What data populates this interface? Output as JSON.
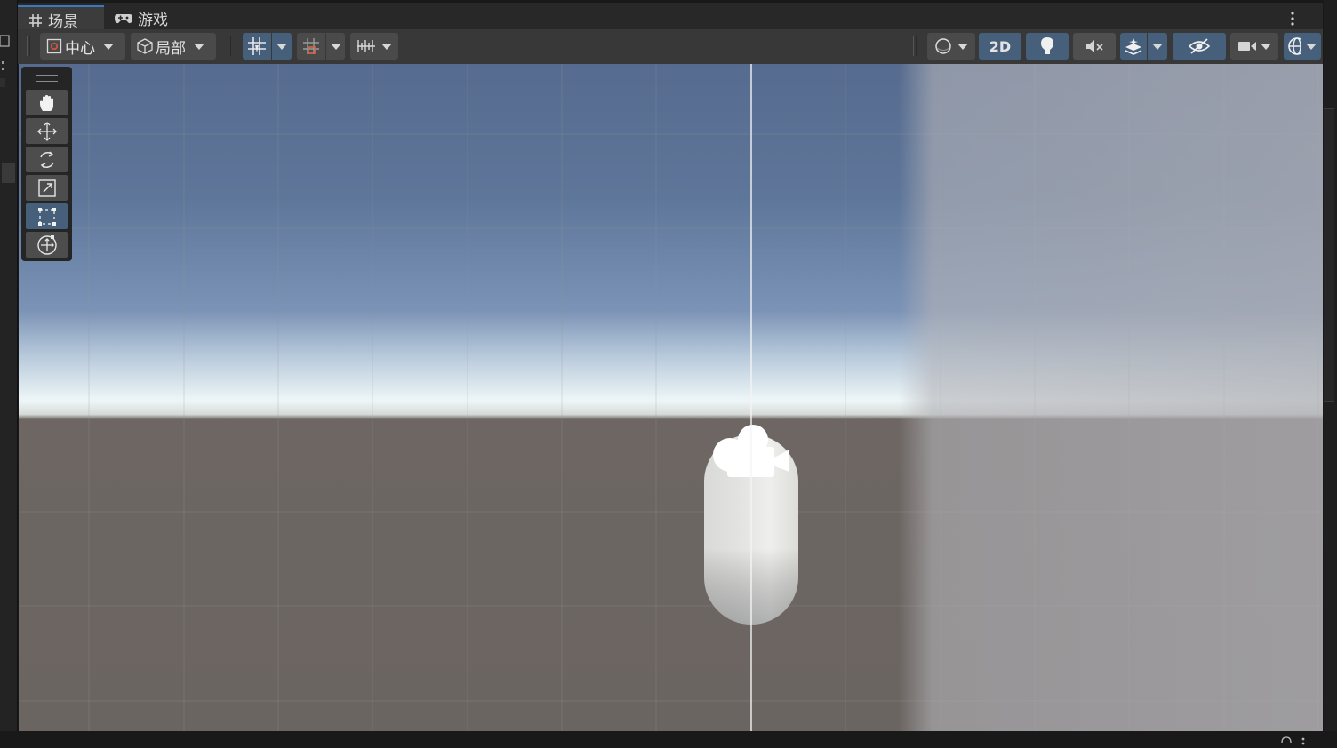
{
  "tabs": [
    {
      "label": "场景",
      "icon": "grid-icon",
      "active": true
    },
    {
      "label": "游戏",
      "icon": "gamepad-icon",
      "active": false
    }
  ],
  "toolbar": {
    "pivot_label": "中心",
    "space_label": "局部",
    "toggle_2d_label": "2D"
  },
  "scene": {
    "camera_icon": "camera-gizmo-icon",
    "object": "capsule"
  },
  "tools": [
    {
      "name": "hand-tool",
      "icon": "hand-icon",
      "selected": false
    },
    {
      "name": "move-tool",
      "icon": "move-arrows-icon",
      "selected": false
    },
    {
      "name": "rotate-tool",
      "icon": "rotate-icon",
      "selected": false
    },
    {
      "name": "scale-tool",
      "icon": "scale-icon",
      "selected": false
    },
    {
      "name": "rect-tool",
      "icon": "rect-transform-icon",
      "selected": true
    },
    {
      "name": "transform-tool",
      "icon": "transform-icon",
      "selected": false
    }
  ],
  "colors": {
    "accent": "#3a79bb",
    "selected_button": "#46607c"
  }
}
